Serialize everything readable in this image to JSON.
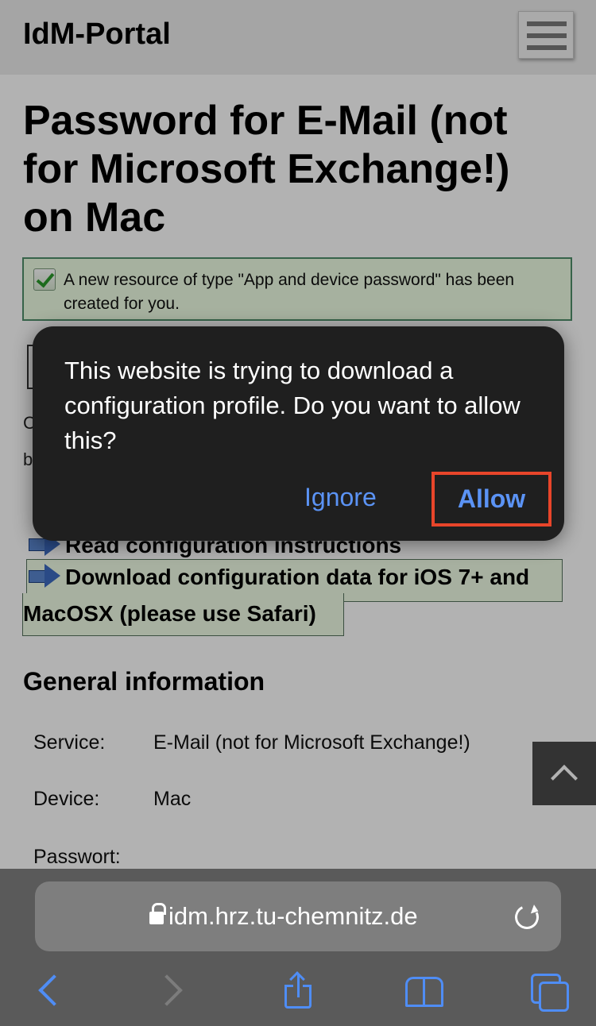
{
  "header": {
    "site_title": "IdM-Portal"
  },
  "page": {
    "title": "Password for E-Mail (not for Microsoft Exchange!) on Mac",
    "success_message": "A new resource of type \"App and device password\" has been created for you.",
    "partial_fragments": [
      "C",
      "b"
    ],
    "links": {
      "instructions": "Read configuration instructions",
      "download_line1": "Download configuration data for iOS 7+ and",
      "download_line2": "MacOSX (please use Safari)"
    },
    "general_info": {
      "heading": "General information",
      "rows": [
        {
          "label": "Service:",
          "value": "E-Mail (not for Microsoft Exchange!)"
        },
        {
          "label": "Device:",
          "value": "Mac"
        },
        {
          "label": "Passwort:",
          "value": ""
        }
      ]
    }
  },
  "alert": {
    "message": "This website is trying to download a configuration profile. Do you want to allow this?",
    "ignore_label": "Ignore",
    "allow_label": "Allow",
    "highlight_color": "#e8452a",
    "button_color": "#5b93f5"
  },
  "browser": {
    "url": "idm.hrz.tu-chemnitz.de",
    "icons": [
      "lock-icon",
      "reload-icon",
      "back-icon",
      "forward-icon",
      "share-icon",
      "bookmarks-icon",
      "tabs-icon"
    ]
  }
}
